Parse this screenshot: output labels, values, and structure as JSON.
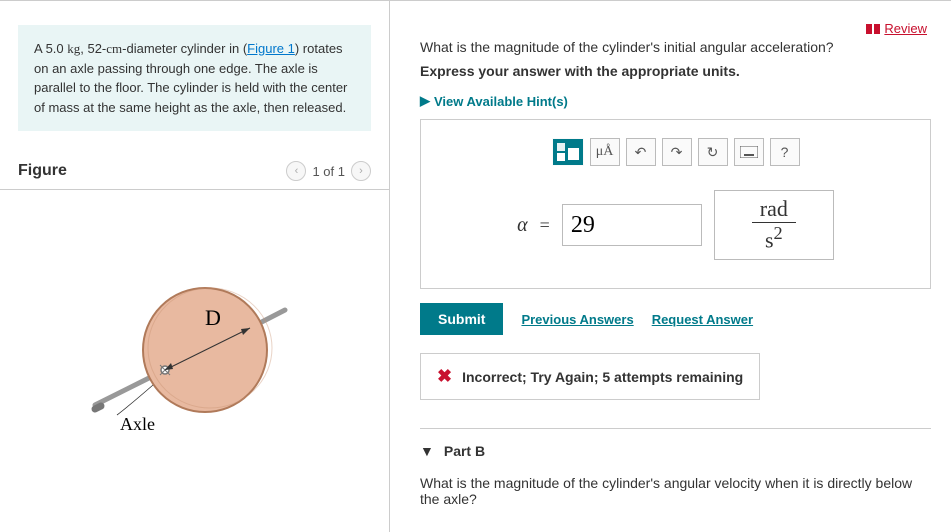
{
  "review": "Review",
  "problem": {
    "prefix": "A 5.0 ",
    "mass_unit": "kg",
    "mid": ", 52-",
    "len_unit": "cm",
    "after": "-diameter cylinder in (",
    "fig_link": "Figure 1",
    "rest": ") rotates on an axle passing through one edge. The axle is parallel to the floor. The cylinder is held with the center of mass at the same height as the axle, then released."
  },
  "figure": {
    "title": "Figure",
    "pager": "1 of 1",
    "d_label": "D",
    "axle_label": "Axle"
  },
  "partA": {
    "question": "What is the magnitude of the cylinder's initial angular acceleration?",
    "instruction": "Express your answer with the appropriate units.",
    "hints": "View Available Hint(s)",
    "alpha": "α",
    "eq": "=",
    "value": "29",
    "unit_top": "rad",
    "unit_bot_base": "s",
    "unit_bot_exp": "2",
    "mua": "μÅ",
    "submit": "Submit",
    "prev": "Previous Answers",
    "request": "Request Answer",
    "feedback": "Incorrect; Try Again; 5 attempts remaining"
  },
  "partB": {
    "header": "Part B",
    "question": "What is the magnitude of the cylinder's angular velocity when it is directly below the axle?"
  }
}
